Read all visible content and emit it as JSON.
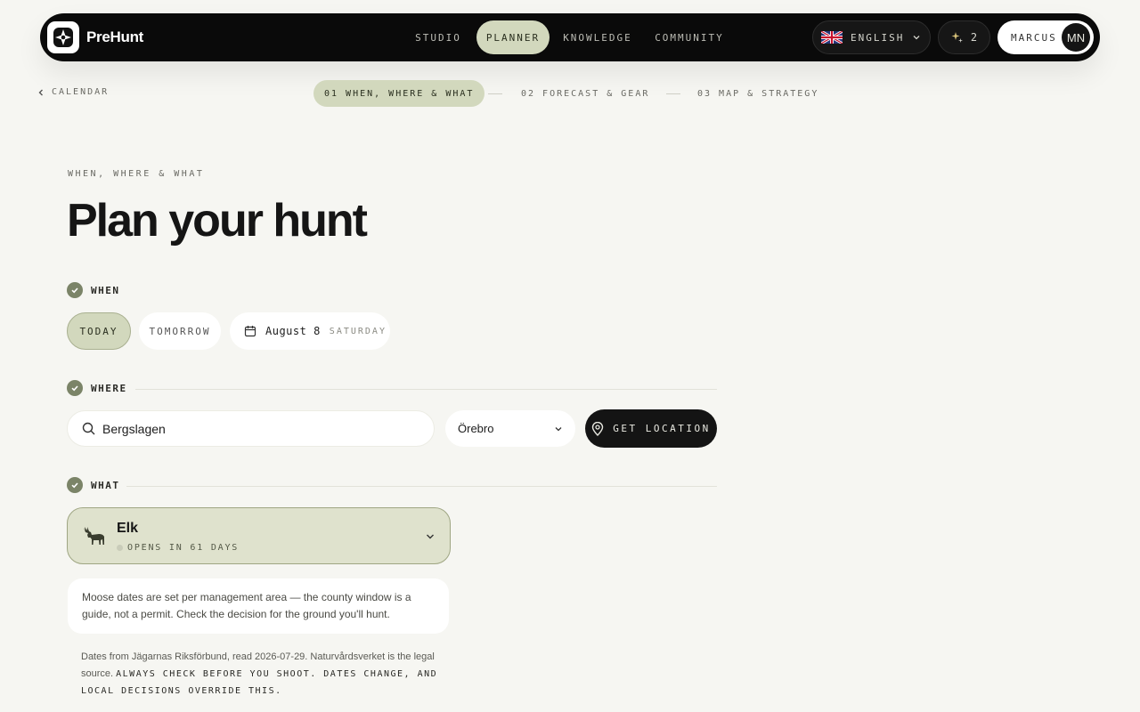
{
  "app": {
    "name": "PreHunt"
  },
  "nav": {
    "items": [
      {
        "label": "STUDIO"
      },
      {
        "label": "PLANNER"
      },
      {
        "label": "KNOWLEDGE"
      },
      {
        "label": "COMMUNITY"
      }
    ],
    "active": "PLANNER"
  },
  "header": {
    "language": "ENGLISH",
    "spark_count": "2",
    "user_name": "MARCUS",
    "user_initials": "MN"
  },
  "steps": {
    "back_label": "CALENDAR",
    "items": [
      {
        "label": "01 WHEN, WHERE & WHAT"
      },
      {
        "label": "02 FORECAST & GEAR"
      },
      {
        "label": "03 MAP & STRATEGY"
      }
    ]
  },
  "page": {
    "eyebrow": "WHEN, WHERE & WHAT",
    "title": "Plan your hunt"
  },
  "when": {
    "label": "WHEN",
    "today": "TODAY",
    "tomorrow": "TOMORROW",
    "date": "August 8",
    "weekday": "SATURDAY"
  },
  "where": {
    "label": "WHERE",
    "search_value": "Bergslagen",
    "region": "Örebro",
    "get_location": "GET LOCATION"
  },
  "what": {
    "label": "WHAT",
    "species": "Elk",
    "opens": "OPENS IN 61 DAYS",
    "note": "Moose dates are set per management area — the county window is a guide, not a permit. Check the decision for the ground you'll hunt.",
    "source": "Dates from Jägarnas Riksförbund, read 2026-07-29.  Naturvårdsverket is the legal source.",
    "warning": "ALWAYS CHECK BEFORE YOU SHOOT. DATES CHANGE, AND LOCAL DECISIONS OVERRIDE THIS."
  },
  "colors": {
    "accent": "#d2d8bd",
    "check": "#7b8468",
    "dark": "#0a0a0a",
    "background": "#f6f6f2"
  },
  "icons": {
    "logo": "compass-star-icon",
    "language": "uk-flag-icon",
    "spark": "sparkle-icon",
    "date": "calendar-icon",
    "search": "search-icon",
    "location": "location-pin-icon",
    "species": "moose-icon"
  }
}
